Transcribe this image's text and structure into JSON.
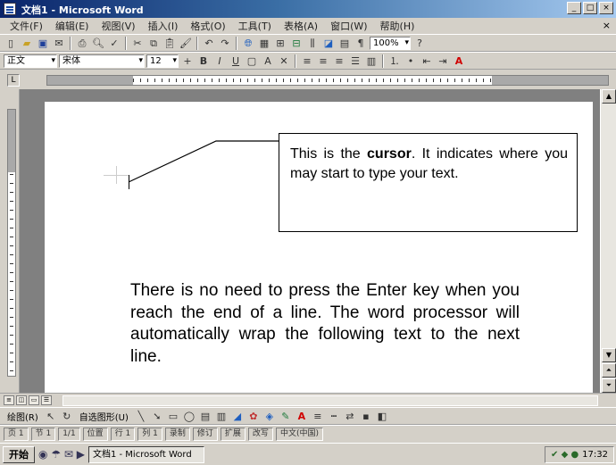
{
  "window": {
    "title": "文档1 - Microsoft Word",
    "controls": [
      "_",
      "□",
      "×"
    ]
  },
  "menubar": {
    "items": [
      "文件(F)",
      "编辑(E)",
      "视图(V)",
      "插入(I)",
      "格式(O)",
      "工具(T)",
      "表格(A)",
      "窗口(W)",
      "帮助(H)"
    ],
    "close_label": "×"
  },
  "toolbar_standard": {
    "zoom_value": "100%"
  },
  "toolbar_format": {
    "style_value": "正文",
    "font_value": "宋体",
    "size_value": "12"
  },
  "document": {
    "callout": {
      "text_before": "This is the ",
      "text_bold": "cursor",
      "text_after": ". It indicates where you may start to type your text."
    },
    "body_text": "There is no need to press the Enter key when you reach the end of a line. The word processor will automatically wrap the following text to the next line."
  },
  "toolbar_drawing": {
    "draw_label": "绘图(R)",
    "autoshapes_label": "自选图形(U)"
  },
  "statusbar": {
    "page": "页 1",
    "section": "节 1",
    "page_of": "1/1",
    "position": "位置",
    "line": "行 1",
    "column": "列 1",
    "modes": [
      "录制",
      "修订",
      "扩展",
      "改写"
    ],
    "language": "中文(中国)"
  },
  "taskbar": {
    "start_label": "开始",
    "task_label": "文档1 - Microsoft Word",
    "clock": "17:32"
  },
  "colors": {
    "titlebar_start": "#0a246a",
    "titlebar_end": "#a6caf0",
    "chrome": "#d4d0c8",
    "workspace": "#808080"
  }
}
